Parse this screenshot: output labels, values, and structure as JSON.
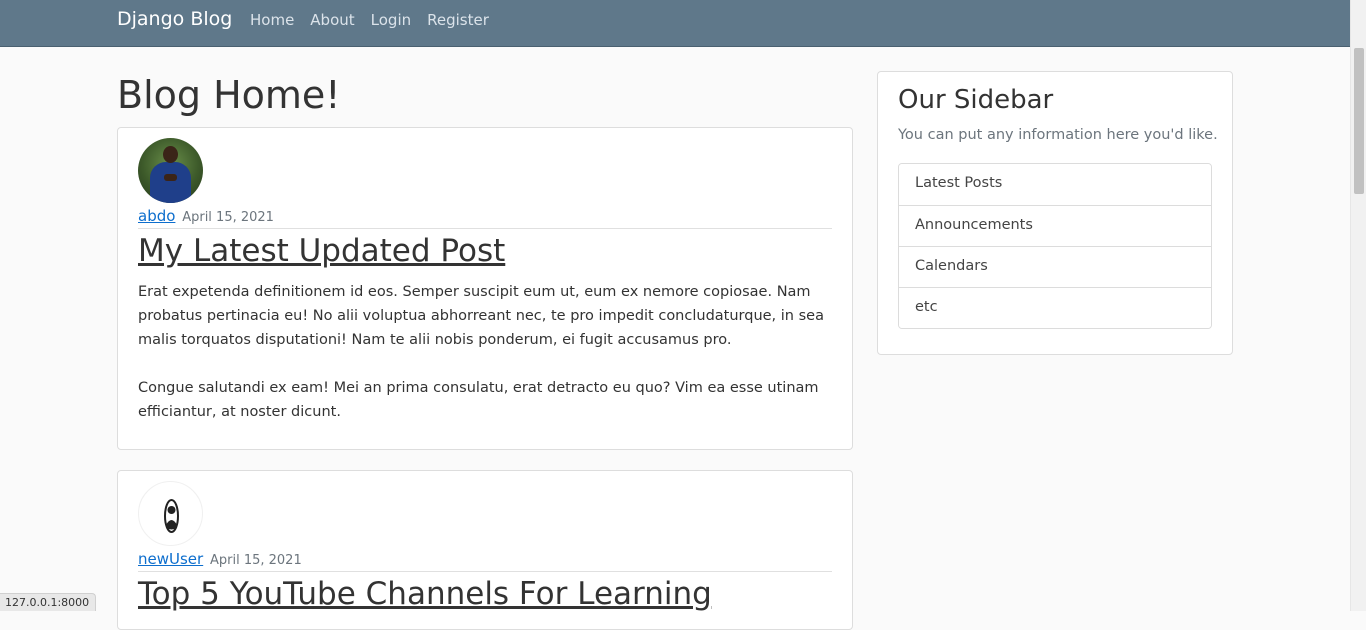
{
  "navbar": {
    "brand": "Django Blog",
    "links": [
      {
        "label": "Home"
      },
      {
        "label": "About"
      },
      {
        "label": "Login"
      },
      {
        "label": "Register"
      }
    ]
  },
  "main": {
    "page_title": "Blog Home!",
    "posts": [
      {
        "author": "abdo",
        "date": "April 15, 2021",
        "title": "My Latest Updated Post",
        "paragraphs": [
          "Erat expetenda definitionem id eos. Semper suscipit eum ut, eum ex nemore copiosae. Nam probatus pertinacia eu! No alii voluptua abhorreant nec, te pro impedit concludaturque, in sea malis torquatos disputationi! Nam te alii nobis ponderum, ei fugit accusamus pro.",
          "Congue salutandi ex eam! Mei an prima consulatu, erat detracto eu quo? Vim ea esse utinam efficiantur, at noster dicunt."
        ]
      },
      {
        "author": "newUser",
        "date": "April 15, 2021",
        "title": "Top 5 YouTube Channels For Learning"
      }
    ]
  },
  "sidebar": {
    "title": "Our Sidebar",
    "text": "You can put any information here you'd like.",
    "items": [
      {
        "label": "Latest Posts"
      },
      {
        "label": "Announcements"
      },
      {
        "label": "Calendars"
      },
      {
        "label": "etc"
      }
    ]
  },
  "status_bar": {
    "url": "127.0.0.1:8000"
  },
  "colors": {
    "navbar": "#5f788a",
    "link": "#0d6ecd",
    "background": "#fafafa"
  }
}
